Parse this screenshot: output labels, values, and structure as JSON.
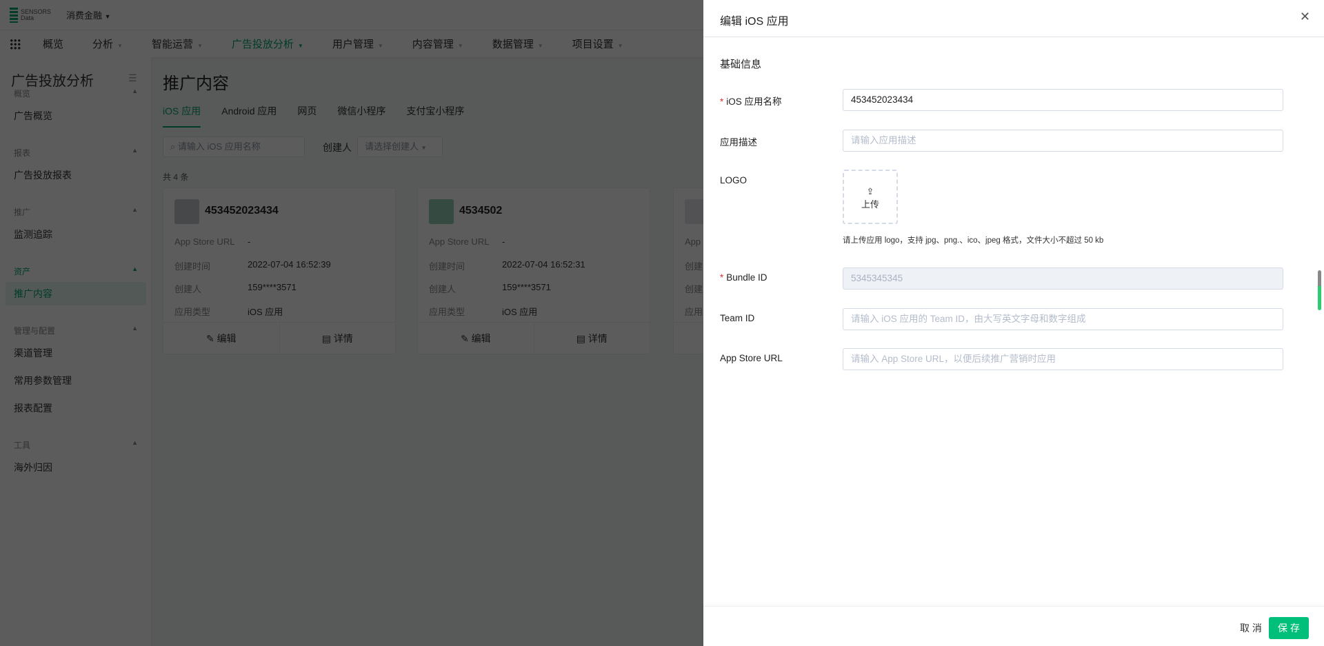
{
  "topbar": {
    "logo_text": "SENSORS Data",
    "project": "消费金融"
  },
  "nav": {
    "items": [
      {
        "label": "概览"
      },
      {
        "label": "分析"
      },
      {
        "label": "智能运营"
      },
      {
        "label": "广告投放分析",
        "active": true
      },
      {
        "label": "用户管理"
      },
      {
        "label": "内容管理"
      },
      {
        "label": "数据管理"
      },
      {
        "label": "项目设置"
      }
    ]
  },
  "sidebar": {
    "title": "广告投放分析",
    "groups": [
      {
        "label": "概览",
        "items": [
          "广告概览"
        ]
      },
      {
        "label": "报表",
        "items": [
          "广告投放报表"
        ]
      },
      {
        "label": "推广",
        "items": [
          "监测追踪"
        ]
      },
      {
        "label": "资产",
        "items": [
          "推广内容"
        ],
        "active": true
      },
      {
        "label": "管理与配置",
        "items": [
          "渠道管理",
          "常用参数管理",
          "报表配置"
        ]
      },
      {
        "label": "工具",
        "items": [
          "海外归因"
        ]
      }
    ]
  },
  "main": {
    "title": "推广内容",
    "tabs": [
      "iOS 应用",
      "Android 应用",
      "网页",
      "微信小程序",
      "支付宝小程序"
    ],
    "search_placeholder": "请输入 iOS 应用名称",
    "creator_label": "创建人",
    "creator_placeholder": "请选择创建人",
    "count": "共 4 条",
    "field_labels": [
      "App Store URL",
      "创建时间",
      "创建人",
      "应用类型"
    ],
    "cards": [
      {
        "name": "453452023434",
        "values": [
          "-",
          "2022-07-04 16:52:39",
          "159****3571",
          "iOS 应用"
        ],
        "edit": "编辑",
        "detail": "详情"
      },
      {
        "name": "4534502",
        "values": [
          "-",
          "2022-07-04 16:52:31",
          "159****3571",
          "iOS 应用"
        ],
        "edit": "编辑",
        "detail": "详情"
      },
      {
        "name": "",
        "values": [
          "",
          "",
          "",
          ""
        ],
        "edit": "",
        "detail": ""
      }
    ]
  },
  "drawer": {
    "title": "编辑 iOS 应用",
    "section": "基础信息",
    "name_label": "iOS 应用名称",
    "name_value": "453452023434",
    "desc_label": "应用描述",
    "desc_placeholder": "请输入应用描述",
    "logo_label": "LOGO",
    "upload_label": "上传",
    "logo_hint": "请上传应用 logo，支持 jpg、png.、ico、jpeg 格式，文件大小不超过 50 kb",
    "bundle_label": "Bundle ID",
    "bundle_value": "5345345345",
    "team_label": "Team ID",
    "team_placeholder": "请输入 iOS 应用的 Team ID，由大写英文字母和数字组成",
    "url_label": "App Store URL",
    "url_placeholder": "请输入 App Store URL，以便后续推广营销时应用",
    "cancel": "取 消",
    "save": "保 存"
  },
  "colors": {
    "accent": "#00a86b",
    "save_button": "#00bf7a",
    "required": "#e3302f"
  }
}
